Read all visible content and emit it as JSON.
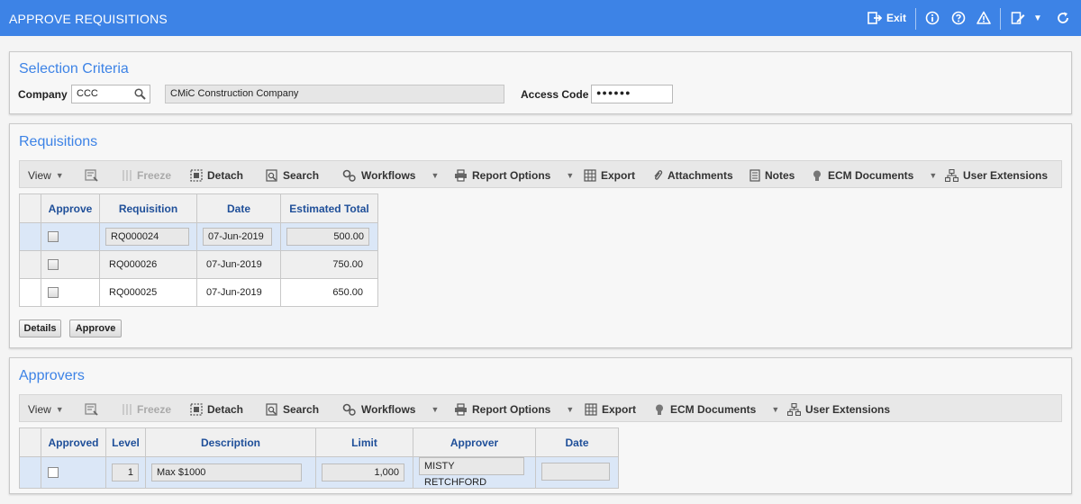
{
  "header": {
    "title": "APPROVE REQUISITIONS",
    "exit_label": "Exit",
    "background": "#3d83e6"
  },
  "selection": {
    "title": "Selection Criteria",
    "company_label": "Company",
    "company_value": "CCC",
    "company_name": "CMiC Construction Company",
    "access_code_label": "Access Code",
    "access_code_value": "●●●●●●"
  },
  "toolbar1": {
    "view": "View",
    "freeze": "Freeze",
    "detach": "Detach",
    "search": "Search",
    "workflows": "Workflows",
    "report_options": "Report Options",
    "export": "Export",
    "attachments": "Attachments",
    "notes": "Notes",
    "ecm_documents": "ECM Documents",
    "user_extensions": "User Extensions"
  },
  "toolbar2": {
    "view": "View",
    "freeze": "Freeze",
    "detach": "Detach",
    "search": "Search",
    "workflows": "Workflows",
    "report_options": "Report Options",
    "export": "Export",
    "ecm_documents": "ECM Documents",
    "user_extensions": "User Extensions"
  },
  "requisitions": {
    "title": "Requisitions",
    "columns": [
      "Approve",
      "Requisition",
      "Date",
      "Estimated Total"
    ],
    "rows": [
      {
        "requisition": "RQ000024",
        "date": "07-Jun-2019",
        "total": "500.00"
      },
      {
        "requisition": "RQ000026",
        "date": "07-Jun-2019",
        "total": "750.00"
      },
      {
        "requisition": "RQ000025",
        "date": "07-Jun-2019",
        "total": "650.00"
      }
    ],
    "details_button": "Details",
    "approve_button": "Approve"
  },
  "approvers": {
    "title": "Approvers",
    "columns": [
      "Approved",
      "Level",
      "Description",
      "Limit",
      "Approver",
      "Date"
    ],
    "rows": [
      {
        "level": "1",
        "description": "Max $1000",
        "limit": "1,000",
        "approver": "MISTY RETCHFORD",
        "date": ""
      }
    ]
  }
}
